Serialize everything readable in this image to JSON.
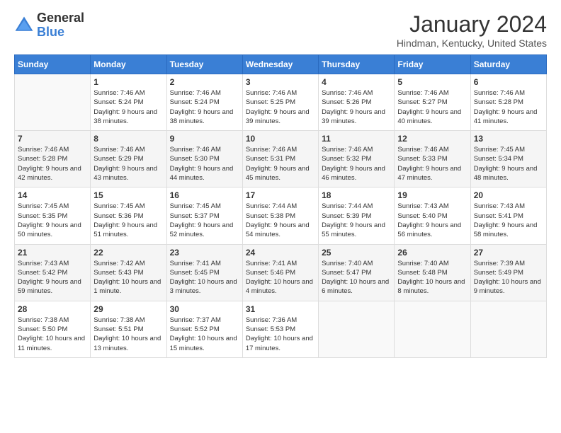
{
  "logo": {
    "general": "General",
    "blue": "Blue"
  },
  "title": "January 2024",
  "location": "Hindman, Kentucky, United States",
  "days_of_week": [
    "Sunday",
    "Monday",
    "Tuesday",
    "Wednesday",
    "Thursday",
    "Friday",
    "Saturday"
  ],
  "weeks": [
    [
      {
        "day": "",
        "sunrise": "",
        "sunset": "",
        "daylight": ""
      },
      {
        "day": "1",
        "sunrise": "Sunrise: 7:46 AM",
        "sunset": "Sunset: 5:24 PM",
        "daylight": "Daylight: 9 hours and 38 minutes."
      },
      {
        "day": "2",
        "sunrise": "Sunrise: 7:46 AM",
        "sunset": "Sunset: 5:24 PM",
        "daylight": "Daylight: 9 hours and 38 minutes."
      },
      {
        "day": "3",
        "sunrise": "Sunrise: 7:46 AM",
        "sunset": "Sunset: 5:25 PM",
        "daylight": "Daylight: 9 hours and 39 minutes."
      },
      {
        "day": "4",
        "sunrise": "Sunrise: 7:46 AM",
        "sunset": "Sunset: 5:26 PM",
        "daylight": "Daylight: 9 hours and 39 minutes."
      },
      {
        "day": "5",
        "sunrise": "Sunrise: 7:46 AM",
        "sunset": "Sunset: 5:27 PM",
        "daylight": "Daylight: 9 hours and 40 minutes."
      },
      {
        "day": "6",
        "sunrise": "Sunrise: 7:46 AM",
        "sunset": "Sunset: 5:28 PM",
        "daylight": "Daylight: 9 hours and 41 minutes."
      }
    ],
    [
      {
        "day": "7",
        "sunrise": "Sunrise: 7:46 AM",
        "sunset": "Sunset: 5:28 PM",
        "daylight": "Daylight: 9 hours and 42 minutes."
      },
      {
        "day": "8",
        "sunrise": "Sunrise: 7:46 AM",
        "sunset": "Sunset: 5:29 PM",
        "daylight": "Daylight: 9 hours and 43 minutes."
      },
      {
        "day": "9",
        "sunrise": "Sunrise: 7:46 AM",
        "sunset": "Sunset: 5:30 PM",
        "daylight": "Daylight: 9 hours and 44 minutes."
      },
      {
        "day": "10",
        "sunrise": "Sunrise: 7:46 AM",
        "sunset": "Sunset: 5:31 PM",
        "daylight": "Daylight: 9 hours and 45 minutes."
      },
      {
        "day": "11",
        "sunrise": "Sunrise: 7:46 AM",
        "sunset": "Sunset: 5:32 PM",
        "daylight": "Daylight: 9 hours and 46 minutes."
      },
      {
        "day": "12",
        "sunrise": "Sunrise: 7:46 AM",
        "sunset": "Sunset: 5:33 PM",
        "daylight": "Daylight: 9 hours and 47 minutes."
      },
      {
        "day": "13",
        "sunrise": "Sunrise: 7:45 AM",
        "sunset": "Sunset: 5:34 PM",
        "daylight": "Daylight: 9 hours and 48 minutes."
      }
    ],
    [
      {
        "day": "14",
        "sunrise": "Sunrise: 7:45 AM",
        "sunset": "Sunset: 5:35 PM",
        "daylight": "Daylight: 9 hours and 50 minutes."
      },
      {
        "day": "15",
        "sunrise": "Sunrise: 7:45 AM",
        "sunset": "Sunset: 5:36 PM",
        "daylight": "Daylight: 9 hours and 51 minutes."
      },
      {
        "day": "16",
        "sunrise": "Sunrise: 7:45 AM",
        "sunset": "Sunset: 5:37 PM",
        "daylight": "Daylight: 9 hours and 52 minutes."
      },
      {
        "day": "17",
        "sunrise": "Sunrise: 7:44 AM",
        "sunset": "Sunset: 5:38 PM",
        "daylight": "Daylight: 9 hours and 54 minutes."
      },
      {
        "day": "18",
        "sunrise": "Sunrise: 7:44 AM",
        "sunset": "Sunset: 5:39 PM",
        "daylight": "Daylight: 9 hours and 55 minutes."
      },
      {
        "day": "19",
        "sunrise": "Sunrise: 7:43 AM",
        "sunset": "Sunset: 5:40 PM",
        "daylight": "Daylight: 9 hours and 56 minutes."
      },
      {
        "day": "20",
        "sunrise": "Sunrise: 7:43 AM",
        "sunset": "Sunset: 5:41 PM",
        "daylight": "Daylight: 9 hours and 58 minutes."
      }
    ],
    [
      {
        "day": "21",
        "sunrise": "Sunrise: 7:43 AM",
        "sunset": "Sunset: 5:42 PM",
        "daylight": "Daylight: 9 hours and 59 minutes."
      },
      {
        "day": "22",
        "sunrise": "Sunrise: 7:42 AM",
        "sunset": "Sunset: 5:43 PM",
        "daylight": "Daylight: 10 hours and 1 minute."
      },
      {
        "day": "23",
        "sunrise": "Sunrise: 7:41 AM",
        "sunset": "Sunset: 5:45 PM",
        "daylight": "Daylight: 10 hours and 3 minutes."
      },
      {
        "day": "24",
        "sunrise": "Sunrise: 7:41 AM",
        "sunset": "Sunset: 5:46 PM",
        "daylight": "Daylight: 10 hours and 4 minutes."
      },
      {
        "day": "25",
        "sunrise": "Sunrise: 7:40 AM",
        "sunset": "Sunset: 5:47 PM",
        "daylight": "Daylight: 10 hours and 6 minutes."
      },
      {
        "day": "26",
        "sunrise": "Sunrise: 7:40 AM",
        "sunset": "Sunset: 5:48 PM",
        "daylight": "Daylight: 10 hours and 8 minutes."
      },
      {
        "day": "27",
        "sunrise": "Sunrise: 7:39 AM",
        "sunset": "Sunset: 5:49 PM",
        "daylight": "Daylight: 10 hours and 9 minutes."
      }
    ],
    [
      {
        "day": "28",
        "sunrise": "Sunrise: 7:38 AM",
        "sunset": "Sunset: 5:50 PM",
        "daylight": "Daylight: 10 hours and 11 minutes."
      },
      {
        "day": "29",
        "sunrise": "Sunrise: 7:38 AM",
        "sunset": "Sunset: 5:51 PM",
        "daylight": "Daylight: 10 hours and 13 minutes."
      },
      {
        "day": "30",
        "sunrise": "Sunrise: 7:37 AM",
        "sunset": "Sunset: 5:52 PM",
        "daylight": "Daylight: 10 hours and 15 minutes."
      },
      {
        "day": "31",
        "sunrise": "Sunrise: 7:36 AM",
        "sunset": "Sunset: 5:53 PM",
        "daylight": "Daylight: 10 hours and 17 minutes."
      },
      {
        "day": "",
        "sunrise": "",
        "sunset": "",
        "daylight": ""
      },
      {
        "day": "",
        "sunrise": "",
        "sunset": "",
        "daylight": ""
      },
      {
        "day": "",
        "sunrise": "",
        "sunset": "",
        "daylight": ""
      }
    ]
  ]
}
